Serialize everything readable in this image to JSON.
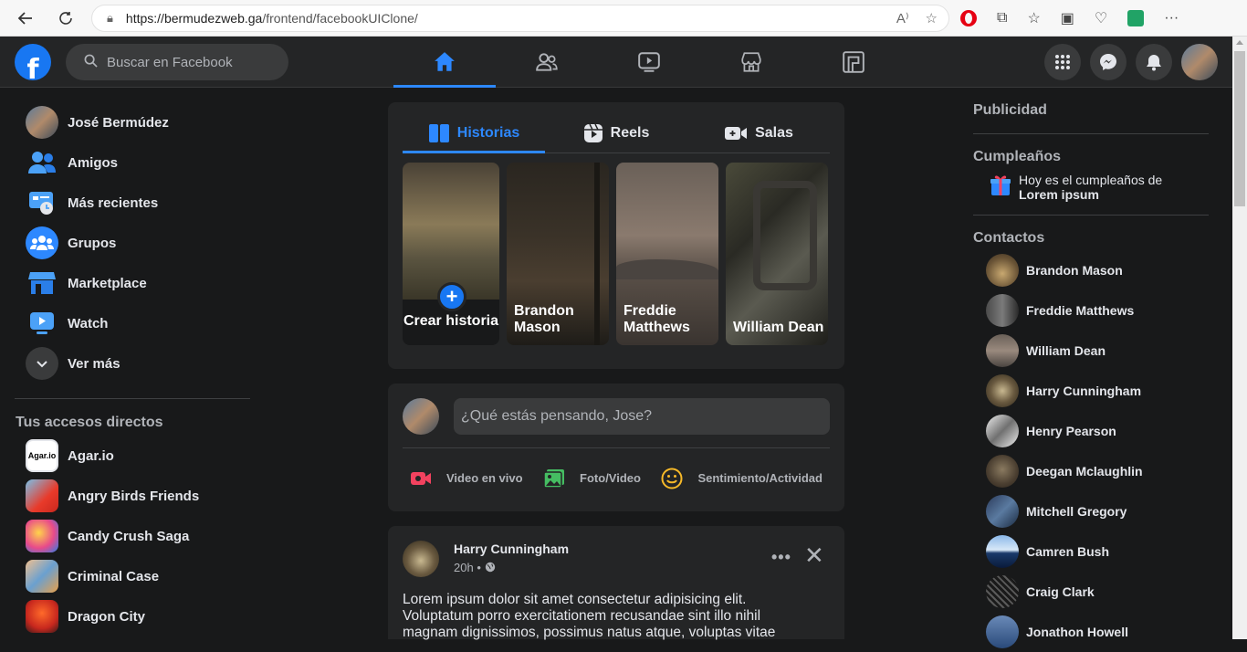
{
  "browser": {
    "url_host": "https://bermudezweb.ga",
    "url_path": "/frontend/facebookUIClone/"
  },
  "header": {
    "logo": "f",
    "search_placeholder": "Buscar en Facebook",
    "accent": "#2d88ff"
  },
  "left": {
    "profile_name": "José Bermúdez",
    "items": [
      {
        "label": "Amigos",
        "icon": "friends-icon"
      },
      {
        "label": "Más recientes",
        "icon": "recent-icon"
      },
      {
        "label": "Grupos",
        "icon": "groups-icon"
      },
      {
        "label": "Marketplace",
        "icon": "marketplace-icon"
      },
      {
        "label": "Watch",
        "icon": "watch-icon"
      },
      {
        "label": "Ver más",
        "icon": "chevron-down-icon"
      }
    ],
    "shortcuts_title": "Tus accesos directos",
    "shortcuts": [
      {
        "label": "Agar.io",
        "badge": "Agar.io"
      },
      {
        "label": "Angry Birds Friends"
      },
      {
        "label": "Candy Crush Saga"
      },
      {
        "label": "Criminal Case"
      },
      {
        "label": "Dragon City"
      }
    ]
  },
  "stories": {
    "tabs": [
      "Historias",
      "Reels",
      "Salas"
    ],
    "create_label": "Crear historia",
    "items": [
      {
        "name": "Brandon Mason"
      },
      {
        "name": "Freddie Matthews"
      },
      {
        "name": "William Dean"
      }
    ]
  },
  "composer": {
    "placeholder": "¿Qué estás pensando, Jose?",
    "actions": [
      "Video en vivo",
      "Foto/Video",
      "Sentimiento/Actividad"
    ]
  },
  "post": {
    "author": "Harry Cunningham",
    "time": "20h",
    "separator": "•",
    "text": "Lorem ipsum dolor sit amet consectetur adipisicing elit. Voluptatum porro exercitationem recusandae sint illo nihil magnam dignissimos, possimus natus atque, voluptas vitae"
  },
  "right": {
    "ads_title": "Publicidad",
    "birthdays_title": "Cumpleaños",
    "birthday_text": "Hoy es el cumpleaños de",
    "birthday_name": "Lorem ipsum",
    "contacts_title": "Contactos",
    "contacts": [
      "Brandon Mason",
      "Freddie Matthews",
      "William Dean",
      "Harry Cunningham",
      "Henry Pearson",
      "Deegan Mclaughlin",
      "Mitchell Gregory",
      "Camren Bush",
      "Craig Clark",
      "Jonathon Howell"
    ]
  }
}
